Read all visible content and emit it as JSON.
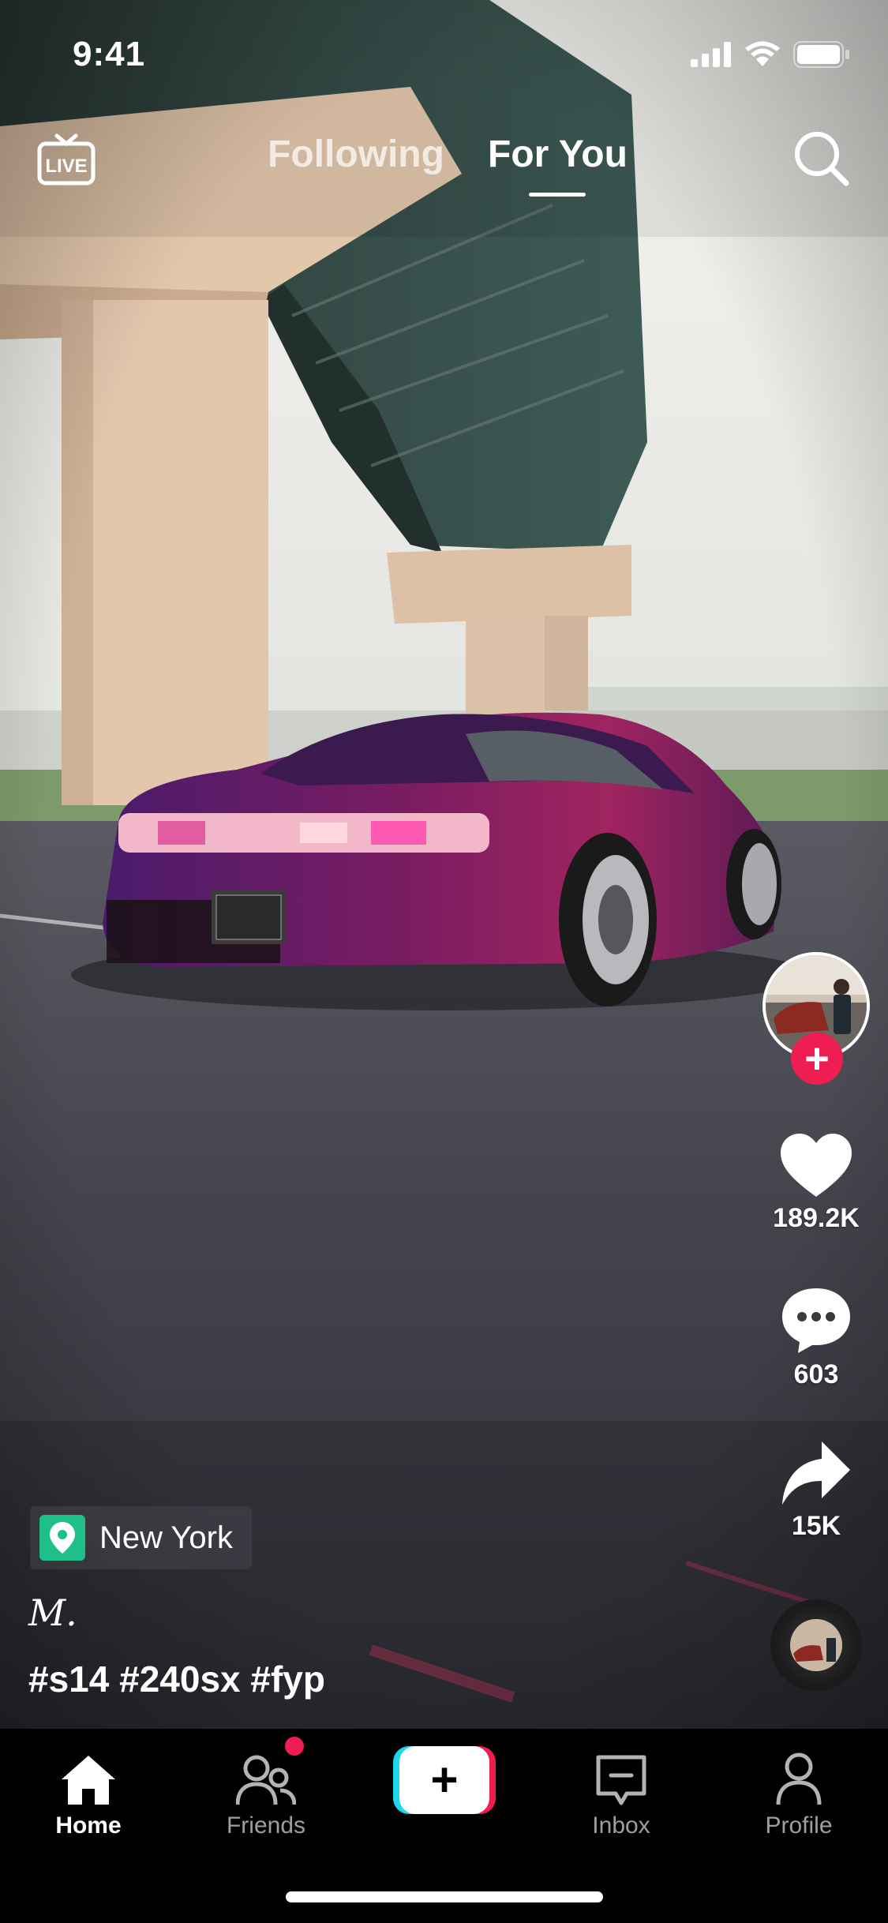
{
  "status_bar": {
    "time": "9:41"
  },
  "top_nav": {
    "tabs": [
      {
        "label": "Following",
        "active": false
      },
      {
        "label": "For You",
        "active": true
      }
    ]
  },
  "actions": {
    "likes": "189.2K",
    "comments": "603",
    "shares": "15K"
  },
  "post": {
    "location": "New York",
    "username": "M.",
    "caption": "#s14 #240sx #fyp"
  },
  "tab_bar": {
    "items": [
      {
        "label": "Home",
        "active": true
      },
      {
        "label": "Friends",
        "active": false,
        "has_badge": true
      },
      {
        "label": "Inbox",
        "active": false
      },
      {
        "label": "Profile",
        "active": false
      }
    ]
  },
  "colors": {
    "accent_red": "#ee1d52",
    "accent_cyan": "#20d5ec",
    "location_green": "#1fbf8a"
  },
  "icons": {
    "live": "live-tv-icon",
    "search": "search-icon",
    "like": "heart-icon",
    "comment": "comment-dots-icon",
    "share": "share-arrow-icon",
    "location": "map-pin-icon",
    "home": "home-icon",
    "friends": "friends-icon",
    "create": "plus-icon",
    "inbox": "inbox-icon",
    "profile": "person-icon"
  }
}
